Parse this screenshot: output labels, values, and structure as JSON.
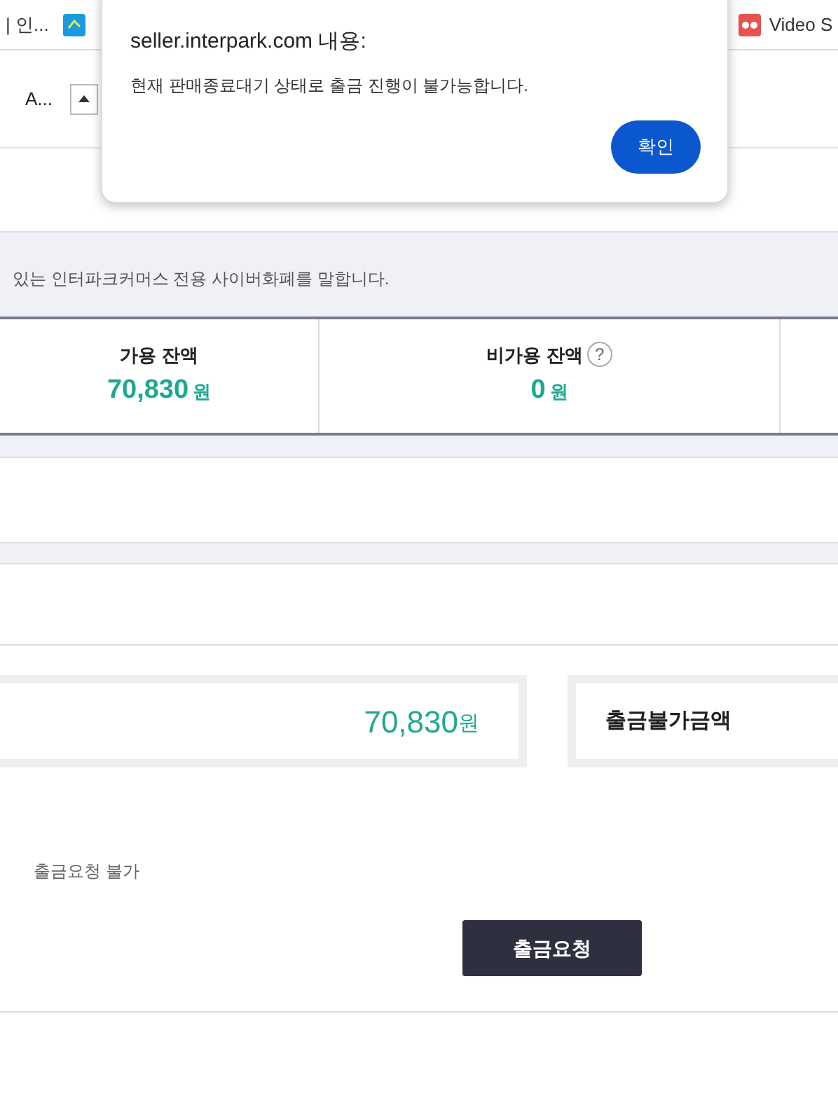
{
  "bookmarks": [
    {
      "label": "| 인..."
    },
    {
      "label": "Video S"
    }
  ],
  "toolbar": {
    "tab_title": "A..."
  },
  "dialog": {
    "title": "seller.interpark.com 내용:",
    "message": "현재 판매종료대기 상태로 출금 진행이 불가능합니다.",
    "button": "확인"
  },
  "notice": "있는 인터파크커머스 전용 사이버화폐를 말합니다.",
  "balances": [
    {
      "label": "가용 잔액",
      "amount": "70,830",
      "unit": "원",
      "help": false
    },
    {
      "label": "비가용 잔액",
      "amount": "0",
      "unit": "원",
      "help": true
    }
  ],
  "help_mark": "?",
  "summary": {
    "amount": "70,830",
    "unit": "원",
    "blocked_label": "출금불가금액"
  },
  "note": "출금요청 불가",
  "request_button": "출금요청"
}
